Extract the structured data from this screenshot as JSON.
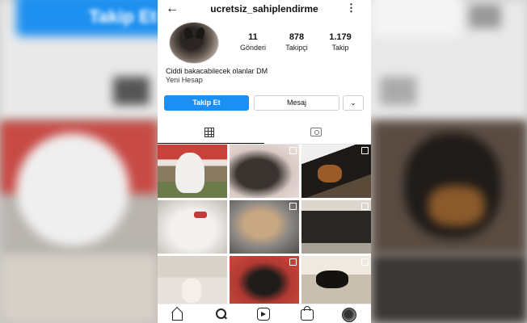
{
  "header": {
    "username": "ucretsiz_sahiplendirme"
  },
  "stats": [
    {
      "value": "11",
      "label": "Gönderi"
    },
    {
      "value": "878",
      "label": "Takipçi"
    },
    {
      "value": "1.179",
      "label": "Takip"
    }
  ],
  "bio": {
    "text": "Ciddi bakacabilecek olanlar DM",
    "category": "Yeni Hesap"
  },
  "actions": {
    "follow_label": "Takip Et",
    "message_label": "Mesaj"
  },
  "backdrop": {
    "follow_label": "Takip Et"
  },
  "colors": {
    "accent": "#1b8ff2",
    "background": "#ffffff"
  },
  "tabs": [
    "grid-icon",
    "tagged-icon"
  ],
  "bottom_nav": [
    "home-icon",
    "search-icon",
    "reels-icon",
    "shop-icon",
    "profile-icon"
  ]
}
